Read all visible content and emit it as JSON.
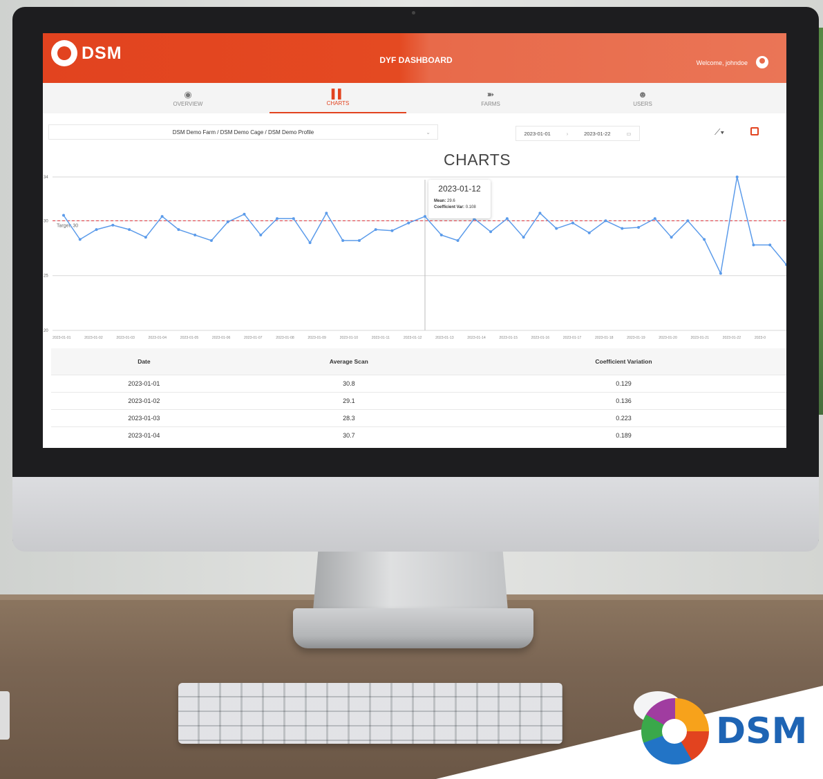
{
  "header": {
    "logo_text": "DSM",
    "title": "DYF DASHBOARD",
    "welcome": "Welcome, johndoe"
  },
  "nav": {
    "tabs": [
      {
        "label": "OVERVIEW",
        "icon": "eye-icon",
        "active": false
      },
      {
        "label": "CHARTS",
        "icon": "bar-chart-icon",
        "active": true
      },
      {
        "label": "FARMS",
        "icon": "fish-icon",
        "active": false
      },
      {
        "label": "USERS",
        "icon": "users-icon",
        "active": false
      }
    ]
  },
  "toolbar": {
    "path": "DSM Demo Farm / DSM Demo Cage / DSM Demo Profile",
    "date_start": "2023-01-01",
    "date_end": "2023-01-22",
    "chart_type_icon": "line-chart-icon",
    "export_icon": "export-icon"
  },
  "page_title": "CHARTS",
  "tooltip": {
    "date": "2023-01-12",
    "mean_label": "Mean:",
    "mean_value": "29.6",
    "cv_label": "Coefficient Var:",
    "cv_value": "0.108"
  },
  "chart_data": {
    "type": "line",
    "target_label": "Target: 30",
    "target": 30,
    "ylim": [
      20,
      34
    ],
    "yticks": [
      20,
      25,
      30,
      34
    ],
    "xtick_labels": [
      "2023-01-01",
      "2023-01-02",
      "2023-01-03",
      "2023-01-04",
      "2023-01-05",
      "2023-01-06",
      "2023-01-07",
      "2023-01-08",
      "2023-01-09",
      "2023-01-10",
      "2023-01-11",
      "2023-01-12",
      "2023-01-13",
      "2023-01-14",
      "2023-01-15",
      "2023-01-16",
      "2023-01-17",
      "2023-01-18",
      "2023-01-19",
      "2023-01-20",
      "2023-01-21",
      "2023-01-22",
      "2023-0"
    ],
    "values": [
      30.5,
      28.3,
      29.2,
      29.6,
      29.2,
      28.5,
      30.4,
      29.2,
      28.7,
      28.2,
      29.9,
      30.6,
      28.7,
      30.2,
      30.2,
      28.0,
      30.7,
      28.2,
      28.2,
      29.2,
      29.1,
      29.8,
      30.4,
      28.7,
      28.2,
      30.2,
      29.0,
      30.2,
      28.5,
      30.7,
      29.3,
      29.8,
      28.9,
      30.0,
      29.3,
      29.4,
      30.2,
      28.5,
      30.0,
      28.3,
      25.2,
      34.0,
      27.8,
      27.8,
      26.0
    ],
    "tooltip_index": 22,
    "line_color": "#5b9bea",
    "target_color": "#e0303a"
  },
  "table": {
    "headers": [
      "Date",
      "Average Scan",
      "Coefficient Variation"
    ],
    "rows": [
      [
        "2023-01-01",
        "30.8",
        "0.129"
      ],
      [
        "2023-01-02",
        "29.1",
        "0.136"
      ],
      [
        "2023-01-03",
        "28.3",
        "0.223"
      ],
      [
        "2023-01-04",
        "30.7",
        "0.189"
      ]
    ]
  },
  "brand": {
    "text": "DSM"
  },
  "colors": {
    "accent": "#e2431f",
    "line": "#5b9bea",
    "target": "#e0303a"
  }
}
